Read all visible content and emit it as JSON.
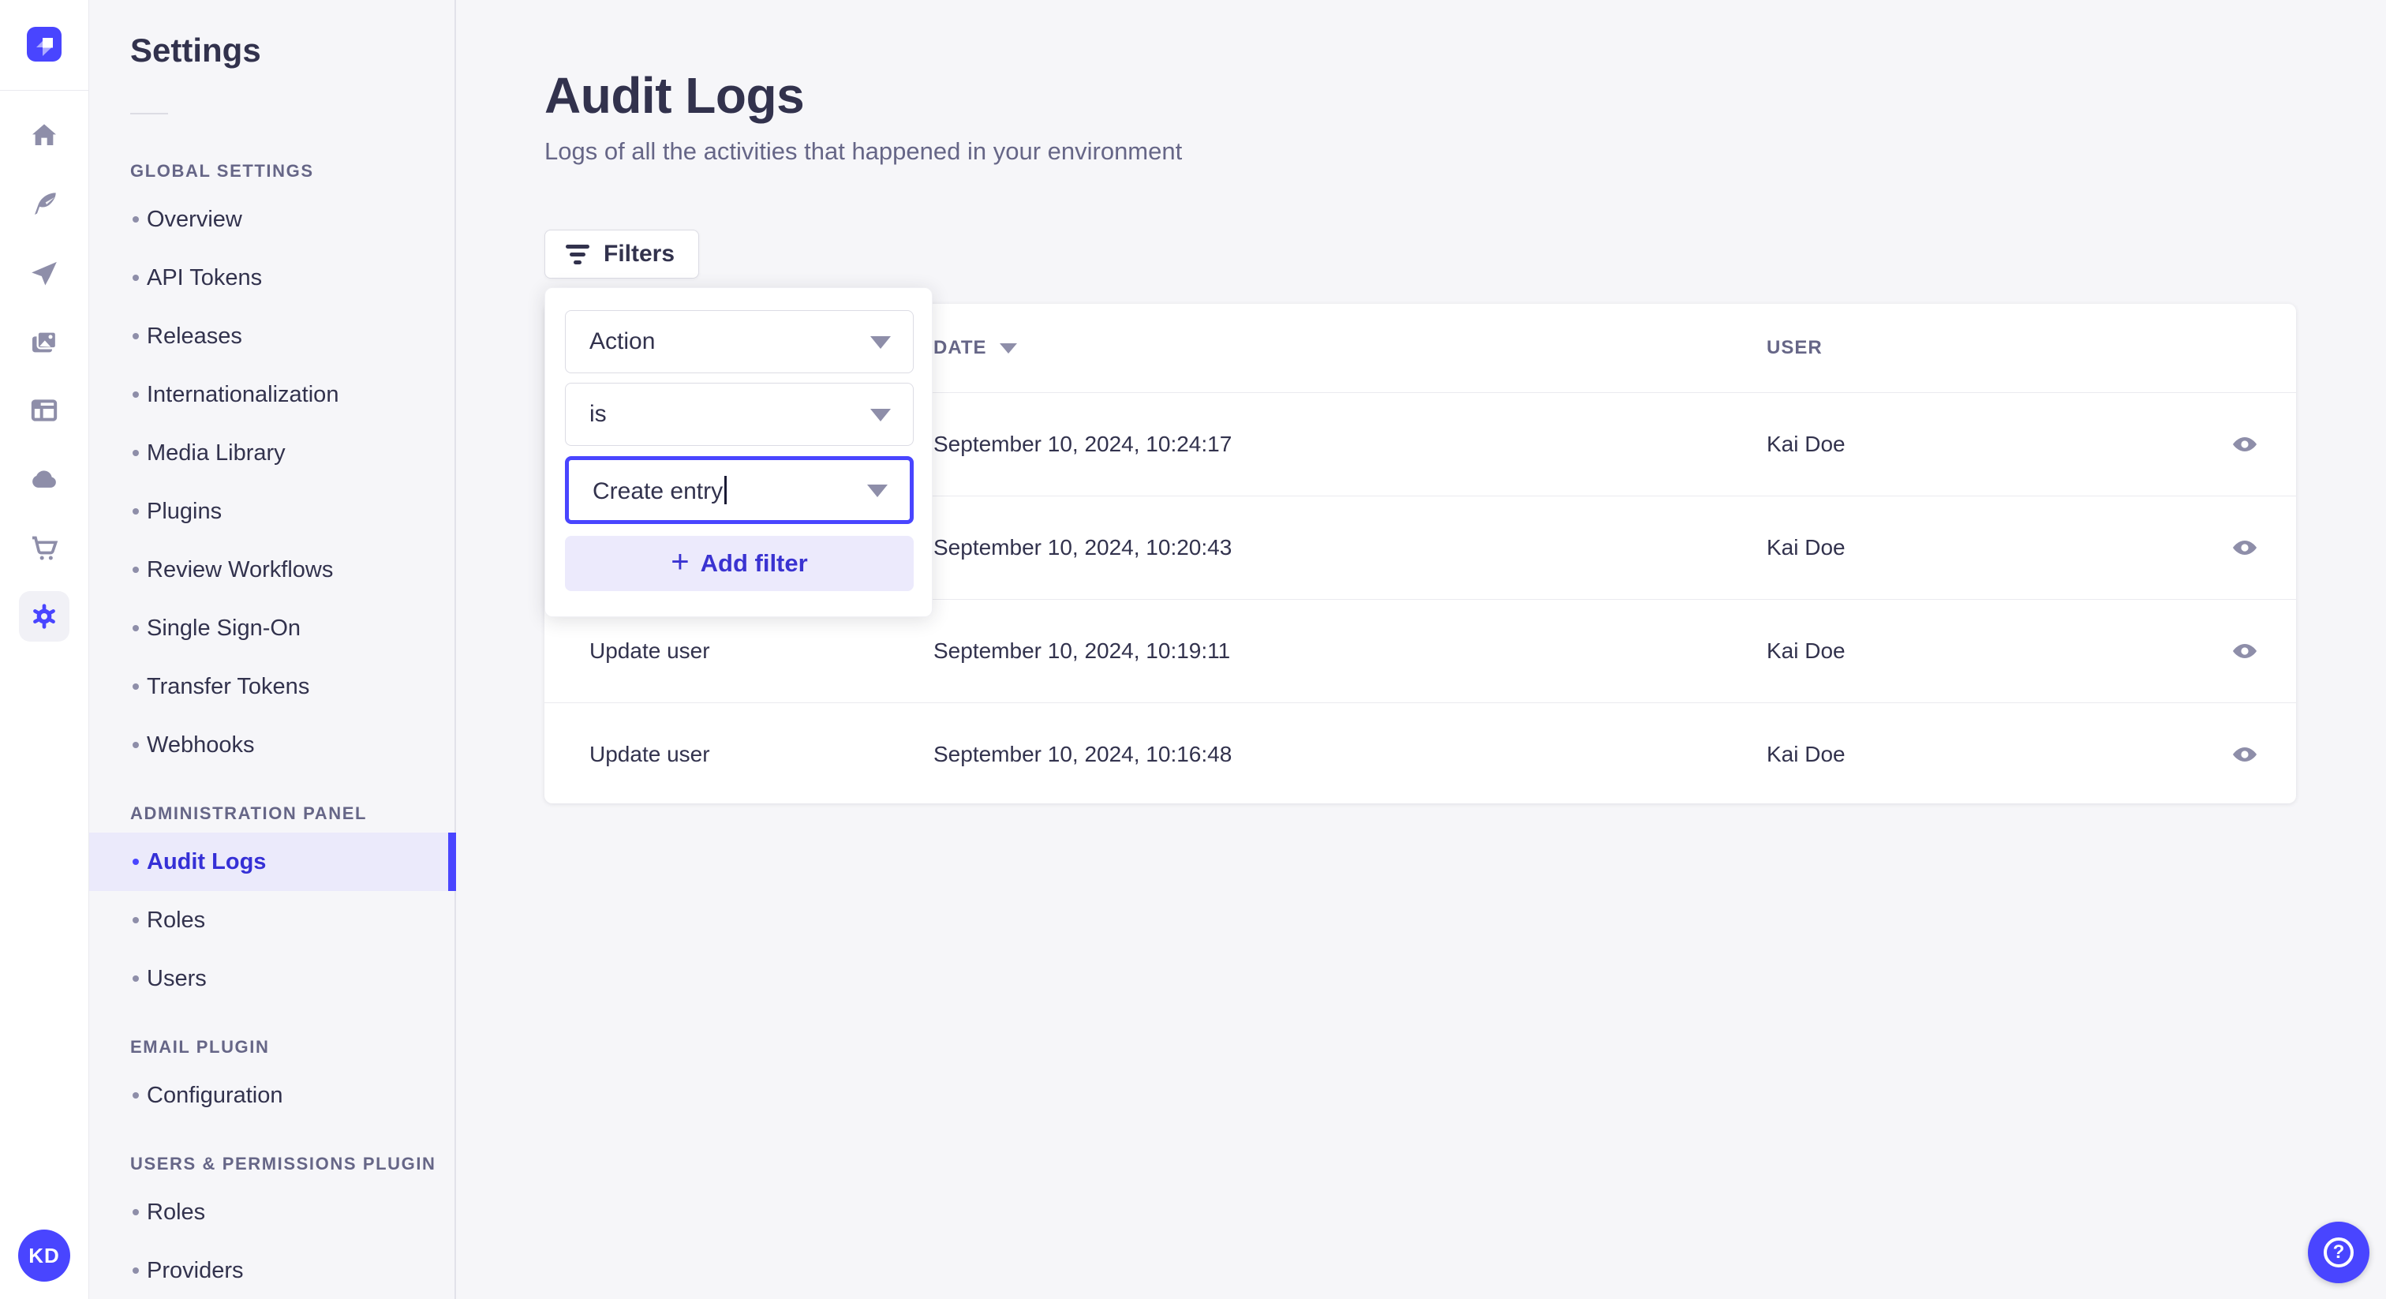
{
  "colors": {
    "accent": "#4945ff",
    "accent_text_active": "#3530d6",
    "active_item_bg": "#ebeafb",
    "add_filter_bg": "#eceafc",
    "text_dark": "#32324d",
    "text_muted": "#666687",
    "icon_gray": "#8e8ea9",
    "page_bg": "#f6f6f9",
    "border_gray": "#dcdce4"
  },
  "nav_rail": {
    "logo_icon": "strapi-logo",
    "items": [
      {
        "icon": "home-icon",
        "active": false
      },
      {
        "icon": "feather-icon",
        "active": false
      },
      {
        "icon": "paper-plane-icon",
        "active": false
      },
      {
        "icon": "pictures-icon",
        "active": false
      },
      {
        "icon": "layout-icon",
        "active": false
      },
      {
        "icon": "cloud-icon",
        "active": false
      },
      {
        "icon": "cart-icon",
        "active": false
      },
      {
        "icon": "gear-icon",
        "active": true
      }
    ],
    "avatar_initials": "KD"
  },
  "sidebar": {
    "title": "Settings",
    "sections": [
      {
        "label": "GLOBAL SETTINGS",
        "items": [
          {
            "label": "Overview",
            "active": false
          },
          {
            "label": "API Tokens",
            "active": false
          },
          {
            "label": "Releases",
            "active": false
          },
          {
            "label": "Internationalization",
            "active": false
          },
          {
            "label": "Media Library",
            "active": false
          },
          {
            "label": "Plugins",
            "active": false
          },
          {
            "label": "Review Workflows",
            "active": false
          },
          {
            "label": "Single Sign-On",
            "active": false
          },
          {
            "label": "Transfer Tokens",
            "active": false
          },
          {
            "label": "Webhooks",
            "active": false
          }
        ]
      },
      {
        "label": "ADMINISTRATION PANEL",
        "items": [
          {
            "label": "Audit Logs",
            "active": true
          },
          {
            "label": "Roles",
            "active": false
          },
          {
            "label": "Users",
            "active": false
          }
        ]
      },
      {
        "label": "EMAIL PLUGIN",
        "items": [
          {
            "label": "Configuration",
            "active": false
          }
        ]
      },
      {
        "label": "USERS & PERMISSIONS PLUGIN",
        "items": [
          {
            "label": "Roles",
            "active": false
          },
          {
            "label": "Providers",
            "active": false
          }
        ]
      }
    ]
  },
  "main": {
    "title": "Audit Logs",
    "subtitle": "Logs of all the activities that happened in your environment",
    "filters_button": "Filters",
    "filter_icon": "filter-icon"
  },
  "filter_popover": {
    "field": "Action",
    "operator": "is",
    "value": "Create entry",
    "add_filter_label": "Add filter",
    "plus_icon": "plus-icon",
    "chevron_icon": "chevron-down-icon"
  },
  "table": {
    "columns": [
      "",
      "DATE",
      "USER"
    ],
    "sort_icon": "caret-down-icon",
    "row_action_icon": "eye-icon",
    "rows": [
      {
        "action": "",
        "date": "September 10, 2024, 10:24:17",
        "user": "Kai Doe"
      },
      {
        "action": "",
        "date": "September 10, 2024, 10:20:43",
        "user": "Kai Doe"
      },
      {
        "action": "Update user",
        "date": "September 10, 2024, 10:19:11",
        "user": "Kai Doe"
      },
      {
        "action": "Update user",
        "date": "September 10, 2024, 10:16:48",
        "user": "Kai Doe"
      }
    ]
  },
  "help_button": {
    "icon": "question-mark-icon"
  }
}
